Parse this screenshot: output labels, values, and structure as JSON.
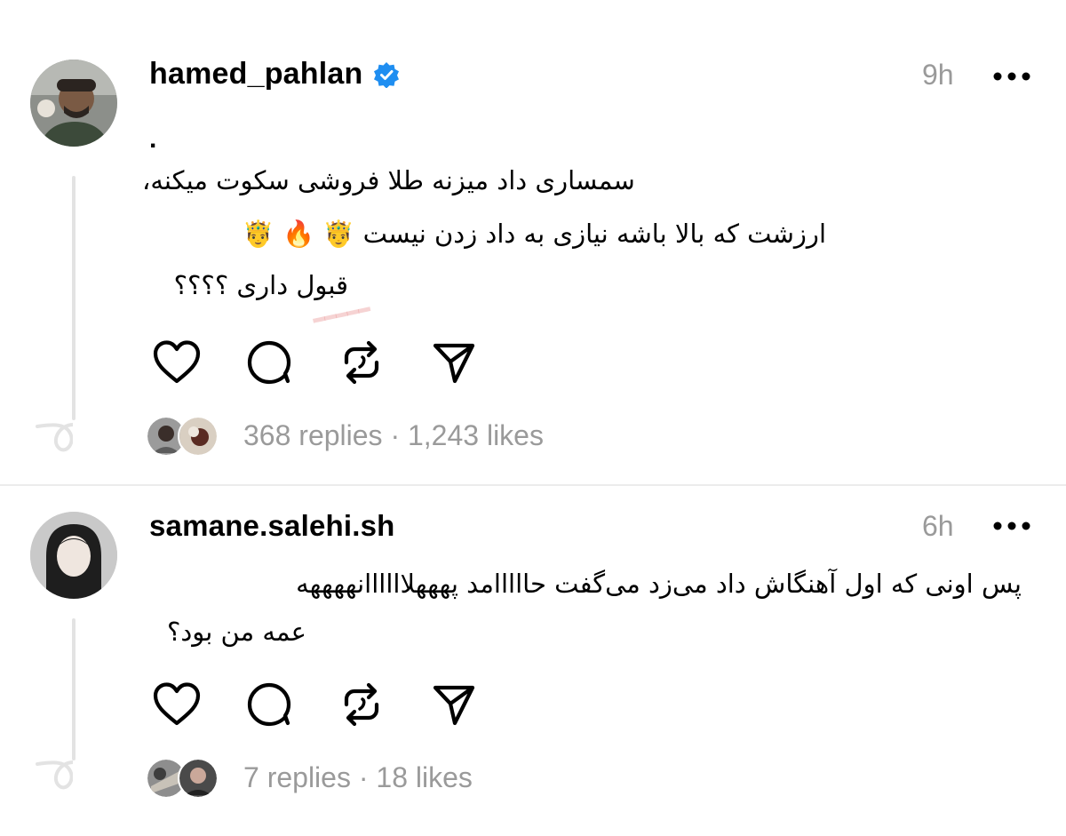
{
  "posts": [
    {
      "username": "hamed_pahlan",
      "verified": true,
      "time": "9h",
      "dot": ".",
      "lines": [
        "سمساری داد میزنه طلا فروشی سکوت میکنه،",
        "ارزشت که بالا باشه نیازی به داد زدن نیست 🤴 🔥 🤴",
        "قبول داری ؟؟؟؟"
      ],
      "stats": "368 replies · 1,243 likes"
    },
    {
      "username": "samane.salehi.sh",
      "verified": false,
      "time": "6h",
      "lines": [
        "پس اونی که اول آهنگاش داد می‌زد می‌گفت حااااامد پهههلاااااانههههه",
        "عمه من بود؟"
      ],
      "stats": "7 replies · 18 likes"
    }
  ],
  "icons": [
    "heart-icon",
    "comment-icon",
    "repost-icon",
    "share-icon",
    "more-icon",
    "verified-icon"
  ],
  "colors": {
    "verified_blue": "#1f8ef1",
    "muted_gray": "#9a9a9a",
    "thread_line": "#e3e3e3"
  }
}
